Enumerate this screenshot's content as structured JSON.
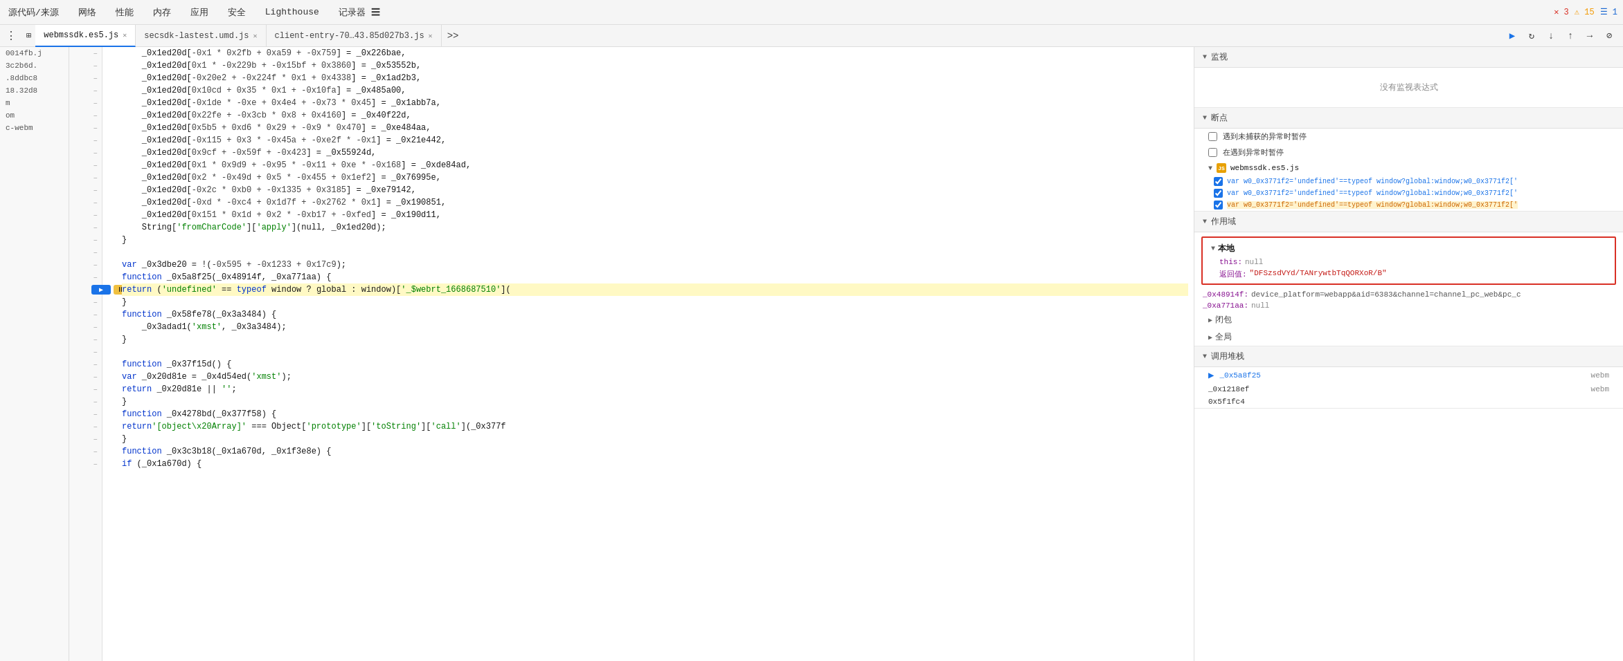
{
  "menu": {
    "items": [
      "源代码/来源",
      "网络",
      "性能",
      "内存",
      "应用",
      "安全",
      "Lighthouse",
      "记录器 ☰"
    ]
  },
  "status": {
    "errors": "✕ 3",
    "warnings": "⚠ 15",
    "info": "☰ 1"
  },
  "tabs": [
    {
      "label": "webmssdk.es5.js",
      "active": true,
      "closable": true
    },
    {
      "label": "secsdk-lastest.umd.js",
      "active": false,
      "closable": true
    },
    {
      "label": "client-entry-70…43.85d027b3.js",
      "active": false,
      "closable": true
    }
  ],
  "source_files": [
    "0014fb.j",
    "3c2b6d.",
    ".8ddbc8",
    "18.32d8",
    "m",
    "om",
    "c-webm"
  ],
  "code_lines": [
    {
      "num": "",
      "content": "    _0x1ed20d[-0x1 * 0x2fb + 0xa59 + -0x759] = _0x226bae,"
    },
    {
      "num": "",
      "content": "    _0x1ed20d[0x1 * -0x229b + -0x15bf + 0x3860] = _0x53552b,"
    },
    {
      "num": "",
      "content": "    _0x1ed20d[-0x20e2 + -0x224f * 0x1 + 0x4338] = _0x1ad2b3,"
    },
    {
      "num": "",
      "content": "    _0x1ed20d[0x10cd + 0x35 * 0x1 + -0x10fa] = _0x485a00,"
    },
    {
      "num": "",
      "content": "    _0x1ed20d[-0x1de * -0xe + 0x4e4 + -0x73 * 0x45] = _0x1abb7a,"
    },
    {
      "num": "",
      "content": "    _0x1ed20d[0x22fe + -0x3cb * 0x8 + 0x4160] = _0x40f22d,"
    },
    {
      "num": "",
      "content": "    _0x1ed20d[0x5b5 + 0xd6 * 0x29 + -0x9 * 0x470] = _0xe484aa,"
    },
    {
      "num": "",
      "content": "    _0x1ed20d[-0x115 + 0x3 * -0x45a + -0xe2f * -0x1] = _0x21e442,"
    },
    {
      "num": "",
      "content": "    _0x1ed20d[0x9cf + -0x59f + -0x423] = _0x55924d,"
    },
    {
      "num": "",
      "content": "    _0x1ed20d[0x1 * 0x9d9 + -0x95 * -0x11 + 0xe * -0x168] = _0xde84ad,"
    },
    {
      "num": "",
      "content": "    _0x1ed20d[0x2 * -0x49d + 0x5 * -0x455 + 0x1ef2] = _0x76995e,"
    },
    {
      "num": "",
      "content": "    _0x1ed20d[-0x2c * 0xb0 + -0x1335 + 0x3185] = _0xe79142,"
    },
    {
      "num": "",
      "content": "    _0x1ed20d[-0xd * -0xc4 + 0x1d7f + -0x2762 * 0x1] = _0x190851,"
    },
    {
      "num": "",
      "content": "    _0x1ed20d[0x151 * 0x1d + 0x2 * -0xb17 + -0xfed] = _0x190d11,"
    },
    {
      "num": "",
      "content": "    String['fromCharCode']['apply'](null, _0x1ed20d);"
    },
    {
      "num": "",
      "content": "}"
    },
    {
      "num": "",
      "content": ""
    },
    {
      "num": "",
      "content": "var _0x3dbe20 = !(-0x595 + -0x1233 + 0x17c9);"
    },
    {
      "num": "",
      "content": "function _0x5a8f25(_0x48914f, _0xa771aa) {"
    },
    {
      "num": "",
      "content": "    return ('undefined' == typeof window ? global : window)['_$webrt_1668687510'](",
      "highlighted": true,
      "execution": true
    },
    {
      "num": "",
      "content": "}"
    },
    {
      "num": "",
      "content": "function _0x58fe78(_0x3a3484) {"
    },
    {
      "num": "",
      "content": "    _0x3adad1('xmst', _0x3a3484);"
    },
    {
      "num": "",
      "content": "}"
    },
    {
      "num": "",
      "content": ""
    },
    {
      "num": "",
      "content": "function _0x37f15d() {"
    },
    {
      "num": "",
      "content": "    var _0x20d81e = _0x4d54ed('xmst');"
    },
    {
      "num": "",
      "content": "    return _0x20d81e || '';"
    },
    {
      "num": "",
      "content": "}"
    },
    {
      "num": "",
      "content": "function _0x4278bd(_0x377f58) {"
    },
    {
      "num": "",
      "content": "    return '[object\\x20Array]' === Object['prototype']['toString']['call'](_0x377f"
    },
    {
      "num": "",
      "content": "}"
    },
    {
      "num": "",
      "content": "function _0x3c3b18(_0x1a670d, _0x1f3e8e) {"
    },
    {
      "num": "",
      "content": "    if (_0x1a670d) {"
    }
  ],
  "debugger": {
    "sections": {
      "watch": {
        "label": "监视",
        "empty_text": "没有监视表达式"
      },
      "breakpoints": {
        "label": "断点",
        "checkboxes": [
          {
            "label": "遇到未捕获的异常时暂停",
            "checked": false
          },
          {
            "label": "在遇到异常时暂停",
            "checked": false
          }
        ],
        "source_file": "webmssdk.es5.js",
        "bp_lines": [
          {
            "text": "var w0_0x3771f2='undefined'==typeof window?global:window;w0_0x3771f2['",
            "checked": true,
            "color": "blue"
          },
          {
            "text": "var w0_0x3771f2='undefined'==typeof window?global:window;w0_0x3771f2['",
            "checked": true,
            "color": "blue"
          },
          {
            "text": "var w0_0x3771f2='undefined'==typeof window?global:window;w0_0x3771f2['",
            "checked": true,
            "color": "orange"
          }
        ]
      },
      "scope": {
        "label": "作用域",
        "local": {
          "label": "本地",
          "rows": [
            {
              "key": "this:",
              "val": "null",
              "type": "null"
            },
            {
              "key": "返回值:",
              "val": "\"DFSzsdVYd/TANrywtbTqQORXoR/B\"",
              "type": "string"
            }
          ],
          "extra_rows": [
            {
              "key": "_0x48914f:",
              "val": "device_platform=webapp&aid=6383&channel=channel_pc_web&pc_c"
            },
            {
              "key": "_0xa771aa:",
              "val": "null"
            }
          ]
        },
        "closure_label": "闭包",
        "global_label": "全局"
      },
      "call_stack": {
        "label": "调用堆栈",
        "items": [
          {
            "fn": "_0x5a8f25",
            "file": "webm",
            "active": true
          },
          {
            "fn": "_0x1218ef",
            "file": "webm"
          },
          {
            "fn": "0x5f1fc4",
            "file": ""
          }
        ]
      }
    }
  }
}
